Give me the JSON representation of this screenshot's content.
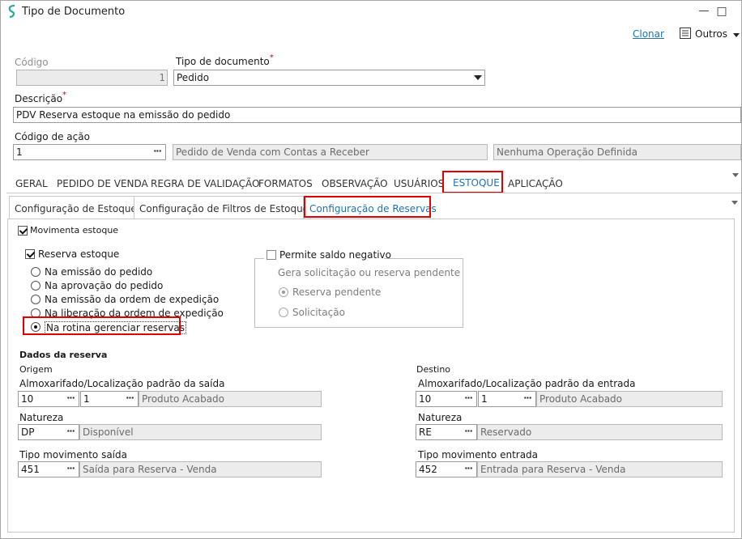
{
  "window": {
    "title": "Tipo de Documento",
    "minimize": "—",
    "maximize": "□",
    "close": "✕"
  },
  "toolbar": {
    "clonar": "Clonar",
    "outros": "Outros"
  },
  "form": {
    "codigo_label": "Código",
    "codigo_value": "1",
    "tipo_label": "Tipo de documento",
    "tipo_value": "Pedido",
    "descricao_label": "Descrição",
    "descricao_value": "PDV Reserva estoque na emissão do pedido",
    "codigo_acao_label": "Código de ação",
    "codigo_acao_value": "1",
    "acao_desc": "Pedido de Venda com Contas a Receber",
    "operacao_desc": "Nenhuma Operação Definida",
    "required_mark": "*",
    "dots": "···"
  },
  "tabs": [
    "GERAL",
    "PEDIDO DE VENDA",
    "REGRA DE VALIDAÇÃO",
    "FORMATOS",
    "OBSERVAÇÃO",
    "USUÁRIOS",
    "ESTOQUE",
    "APLICAÇÃO"
  ],
  "active_tab": "ESTOQUE",
  "subtabs": [
    "Configuração de Estoque",
    "Configuração de Filtros de Estoque",
    "Configuração de Reservas"
  ],
  "active_subtab": "Configuração de Reservas",
  "estoque": {
    "movimenta": "Movimenta estoque",
    "movimenta_checked": true,
    "reserva": "Reserva estoque",
    "reserva_checked": true,
    "reserva_options": [
      "Na emissão do pedido",
      "Na aprovação do pedido",
      "Na emissão da ordem de expedição",
      "Na liberação da ordem de expedição",
      "Na rotina gerenciar reservas"
    ],
    "reserva_selected": "Na rotina gerenciar reservas",
    "permite_saldo": "Permite saldo negativo",
    "permite_checked": false,
    "gera_label": "Gera solicitação ou reserva pendente",
    "gera_options": [
      "Reserva pendente",
      "Solicitação"
    ],
    "gera_selected": "Reserva pendente"
  },
  "reserva": {
    "section_title": "Dados da reserva",
    "origem": {
      "title": "Origem",
      "almox_label": "Almoxarifado/Localização padrão da saída",
      "almox_code": "10",
      "loc_code": "1",
      "loc_desc": "Produto Acabado",
      "natureza_label": "Natureza",
      "natureza_code": "DP",
      "natureza_desc": "Disponível",
      "tipo_label": "Tipo movimento saída",
      "tipo_code": "451",
      "tipo_desc": "Saída para Reserva - Venda"
    },
    "destino": {
      "title": "Destino",
      "almox_label": "Almoxarifado/Localização padrão da entrada",
      "almox_code": "10",
      "loc_code": "1",
      "loc_desc": "Produto Acabado",
      "natureza_label": "Natureza",
      "natureza_code": "RE",
      "natureza_desc": "Reservado",
      "tipo_label": "Tipo movimento entrada",
      "tipo_code": "452",
      "tipo_desc": "Entrada para Reserva - Venda"
    }
  },
  "colors": {
    "accent": "#1f73b7",
    "highlight": "#e00000",
    "logo": "#2aa89a"
  }
}
